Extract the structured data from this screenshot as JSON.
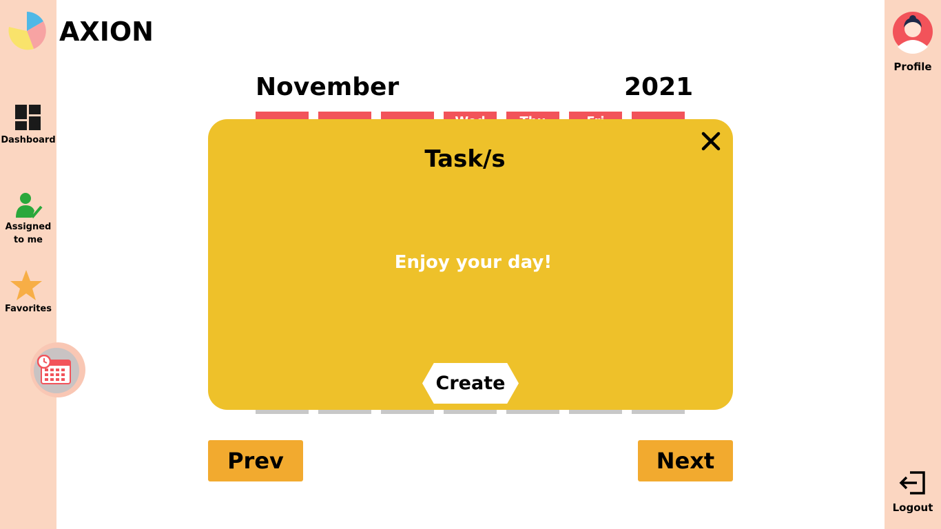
{
  "brand": {
    "name": "AXION",
    "logo_icon": "pie-chart-logo-icon",
    "colors": [
      "#4fb8e6",
      "#f7a3a3",
      "#f9e36b"
    ]
  },
  "sidebar": {
    "items": [
      {
        "label": "Dashboard",
        "icon": "dashboard-grid-icon"
      },
      {
        "label_line1": "Assigned",
        "label_line2": "to me",
        "icon": "user-check-icon"
      },
      {
        "label": "Favorites",
        "icon": "star-icon"
      }
    ],
    "active_item": {
      "icon": "calendar-clock-icon"
    }
  },
  "profile": {
    "label": "Profile",
    "icon": "avatar-icon"
  },
  "logout": {
    "label": "Logout",
    "icon": "logout-icon"
  },
  "calendar": {
    "month": "November",
    "year": "2021",
    "weekday_visible_fragments": [
      "Wed",
      "Thu",
      "Fri"
    ],
    "prev_label": "Prev",
    "next_label": "Next"
  },
  "modal": {
    "title": "Task/s",
    "message": "Enjoy your day!",
    "create_label": "Create",
    "close_icon": "close-icon"
  },
  "colors": {
    "sidebar_bg": "#fbd6c1",
    "modal_bg": "#eec12a",
    "weekday_bg": "#f2535a",
    "nav_button_bg": "#f2aa2f"
  }
}
